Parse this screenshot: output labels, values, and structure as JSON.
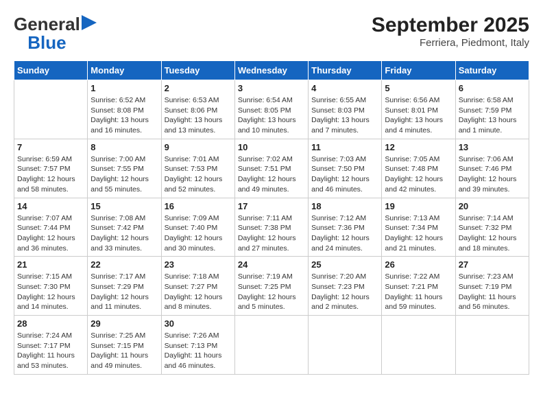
{
  "header": {
    "logo_general": "General",
    "logo_blue": "Blue",
    "title": "September 2025",
    "subtitle": "Ferriera, Piedmont, Italy"
  },
  "columns": [
    "Sunday",
    "Monday",
    "Tuesday",
    "Wednesday",
    "Thursday",
    "Friday",
    "Saturday"
  ],
  "weeks": [
    [
      {
        "day": "",
        "info": ""
      },
      {
        "day": "1",
        "info": "Sunrise: 6:52 AM\nSunset: 8:08 PM\nDaylight: 13 hours\nand 16 minutes."
      },
      {
        "day": "2",
        "info": "Sunrise: 6:53 AM\nSunset: 8:06 PM\nDaylight: 13 hours\nand 13 minutes."
      },
      {
        "day": "3",
        "info": "Sunrise: 6:54 AM\nSunset: 8:05 PM\nDaylight: 13 hours\nand 10 minutes."
      },
      {
        "day": "4",
        "info": "Sunrise: 6:55 AM\nSunset: 8:03 PM\nDaylight: 13 hours\nand 7 minutes."
      },
      {
        "day": "5",
        "info": "Sunrise: 6:56 AM\nSunset: 8:01 PM\nDaylight: 13 hours\nand 4 minutes."
      },
      {
        "day": "6",
        "info": "Sunrise: 6:58 AM\nSunset: 7:59 PM\nDaylight: 13 hours\nand 1 minute."
      }
    ],
    [
      {
        "day": "7",
        "info": "Sunrise: 6:59 AM\nSunset: 7:57 PM\nDaylight: 12 hours\nand 58 minutes."
      },
      {
        "day": "8",
        "info": "Sunrise: 7:00 AM\nSunset: 7:55 PM\nDaylight: 12 hours\nand 55 minutes."
      },
      {
        "day": "9",
        "info": "Sunrise: 7:01 AM\nSunset: 7:53 PM\nDaylight: 12 hours\nand 52 minutes."
      },
      {
        "day": "10",
        "info": "Sunrise: 7:02 AM\nSunset: 7:51 PM\nDaylight: 12 hours\nand 49 minutes."
      },
      {
        "day": "11",
        "info": "Sunrise: 7:03 AM\nSunset: 7:50 PM\nDaylight: 12 hours\nand 46 minutes."
      },
      {
        "day": "12",
        "info": "Sunrise: 7:05 AM\nSunset: 7:48 PM\nDaylight: 12 hours\nand 42 minutes."
      },
      {
        "day": "13",
        "info": "Sunrise: 7:06 AM\nSunset: 7:46 PM\nDaylight: 12 hours\nand 39 minutes."
      }
    ],
    [
      {
        "day": "14",
        "info": "Sunrise: 7:07 AM\nSunset: 7:44 PM\nDaylight: 12 hours\nand 36 minutes."
      },
      {
        "day": "15",
        "info": "Sunrise: 7:08 AM\nSunset: 7:42 PM\nDaylight: 12 hours\nand 33 minutes."
      },
      {
        "day": "16",
        "info": "Sunrise: 7:09 AM\nSunset: 7:40 PM\nDaylight: 12 hours\nand 30 minutes."
      },
      {
        "day": "17",
        "info": "Sunrise: 7:11 AM\nSunset: 7:38 PM\nDaylight: 12 hours\nand 27 minutes."
      },
      {
        "day": "18",
        "info": "Sunrise: 7:12 AM\nSunset: 7:36 PM\nDaylight: 12 hours\nand 24 minutes."
      },
      {
        "day": "19",
        "info": "Sunrise: 7:13 AM\nSunset: 7:34 PM\nDaylight: 12 hours\nand 21 minutes."
      },
      {
        "day": "20",
        "info": "Sunrise: 7:14 AM\nSunset: 7:32 PM\nDaylight: 12 hours\nand 18 minutes."
      }
    ],
    [
      {
        "day": "21",
        "info": "Sunrise: 7:15 AM\nSunset: 7:30 PM\nDaylight: 12 hours\nand 14 minutes."
      },
      {
        "day": "22",
        "info": "Sunrise: 7:17 AM\nSunset: 7:29 PM\nDaylight: 12 hours\nand 11 minutes."
      },
      {
        "day": "23",
        "info": "Sunrise: 7:18 AM\nSunset: 7:27 PM\nDaylight: 12 hours\nand 8 minutes."
      },
      {
        "day": "24",
        "info": "Sunrise: 7:19 AM\nSunset: 7:25 PM\nDaylight: 12 hours\nand 5 minutes."
      },
      {
        "day": "25",
        "info": "Sunrise: 7:20 AM\nSunset: 7:23 PM\nDaylight: 12 hours\nand 2 minutes."
      },
      {
        "day": "26",
        "info": "Sunrise: 7:22 AM\nSunset: 7:21 PM\nDaylight: 11 hours\nand 59 minutes."
      },
      {
        "day": "27",
        "info": "Sunrise: 7:23 AM\nSunset: 7:19 PM\nDaylight: 11 hours\nand 56 minutes."
      }
    ],
    [
      {
        "day": "28",
        "info": "Sunrise: 7:24 AM\nSunset: 7:17 PM\nDaylight: 11 hours\nand 53 minutes."
      },
      {
        "day": "29",
        "info": "Sunrise: 7:25 AM\nSunset: 7:15 PM\nDaylight: 11 hours\nand 49 minutes."
      },
      {
        "day": "30",
        "info": "Sunrise: 7:26 AM\nSunset: 7:13 PM\nDaylight: 11 hours\nand 46 minutes."
      },
      {
        "day": "",
        "info": ""
      },
      {
        "day": "",
        "info": ""
      },
      {
        "day": "",
        "info": ""
      },
      {
        "day": "",
        "info": ""
      }
    ]
  ]
}
